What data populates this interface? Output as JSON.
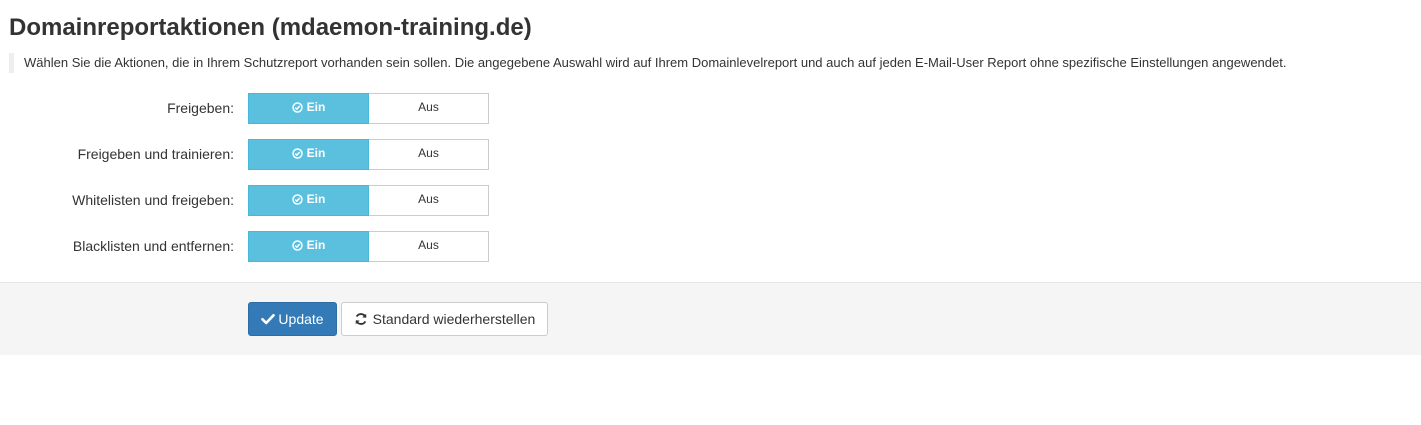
{
  "page": {
    "title": "Domainreportaktionen (mdaemon-training.de)",
    "description": "Wählen Sie die Aktionen, die in Ihrem Schutzreport vorhanden sein sollen. Die angegebene Auswahl wird auf Ihrem Domainlevelreport und auch auf jeden E-Mail-User Report ohne spezifische Einstellungen angewendet."
  },
  "settings": [
    {
      "label": "Freigeben:",
      "on_label": "Ein",
      "off_label": "Aus",
      "state": "on"
    },
    {
      "label": "Freigeben und trainieren:",
      "on_label": "Ein",
      "off_label": "Aus",
      "state": "on"
    },
    {
      "label": "Whitelisten und freigeben:",
      "on_label": "Ein",
      "off_label": "Aus",
      "state": "on"
    },
    {
      "label": "Blacklisten und entfernen:",
      "on_label": "Ein",
      "off_label": "Aus",
      "state": "on"
    }
  ],
  "actions": {
    "update_label": "Update",
    "restore_label": "Standard wiederherstellen"
  },
  "colors": {
    "toggle_on": "#5bc0de",
    "primary": "#337ab7",
    "footer_bg": "#f5f5f5"
  },
  "icons": {
    "toggle_on": "check-circle-icon",
    "update": "checkmark-icon",
    "restore": "refresh-icon"
  }
}
